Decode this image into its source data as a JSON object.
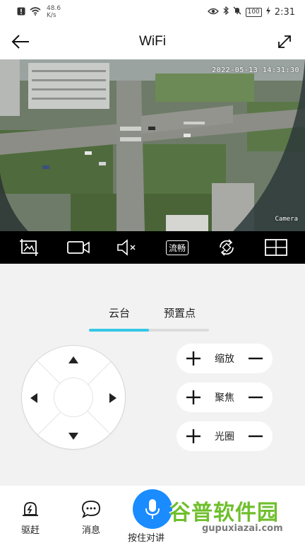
{
  "status_bar": {
    "speed_value": "48.6",
    "speed_unit": "K/s",
    "battery": "100",
    "time": "2:31"
  },
  "header": {
    "title": "WiFi"
  },
  "video": {
    "timestamp": "2022-05-13  14:31:30",
    "camera_label": "Camera"
  },
  "toolbar": {
    "fluency_label": "流畅",
    "icons": [
      "crop-icon",
      "record-video-icon",
      "mute-icon",
      "fluency-badge",
      "rotate-icon",
      "grid-layout-icon"
    ]
  },
  "tabs": [
    {
      "label": "云台"
    },
    {
      "label": "预置点"
    }
  ],
  "ptz_controls": [
    {
      "label": "缩放"
    },
    {
      "label": "聚焦"
    },
    {
      "label": "光圈"
    }
  ],
  "bottom_nav": {
    "expel_label": "驱赶",
    "message_label": "消息",
    "talk_label": "按住对讲"
  },
  "watermark": {
    "cn": "谷普软件园",
    "url": "gupuxiazai.com"
  },
  "colors": {
    "accent": "#35c8e6",
    "talk_button": "#1a8cff",
    "watermark": "#6fbf2c"
  }
}
